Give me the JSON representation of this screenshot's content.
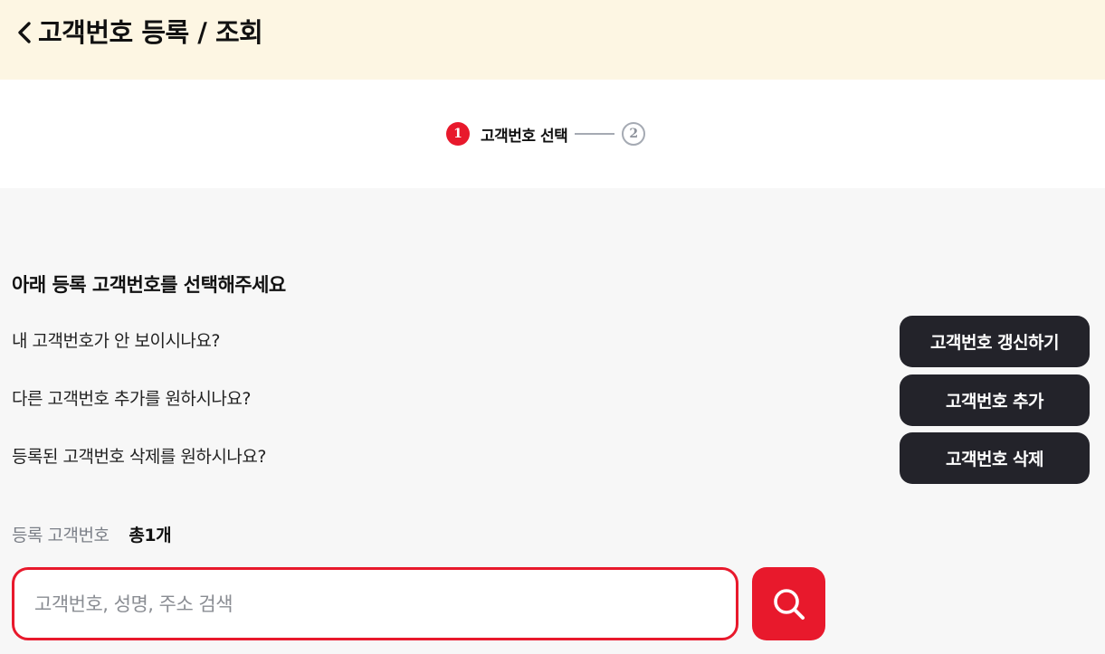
{
  "header": {
    "title": "고객번호 등록 / 조회",
    "back_icon": "chevron-left-icon",
    "background": "#fdf6e3"
  },
  "stepper": {
    "steps": [
      {
        "number": "1",
        "label": "고객번호 선택",
        "active": true
      },
      {
        "number": "2",
        "label": "",
        "active": false
      }
    ],
    "active_color": "#e8192c",
    "inactive_color": "#a5aab3"
  },
  "main": {
    "title": "아래 등록 고객번호를 선택해주세요",
    "questions": [
      {
        "text": "내 고객번호가 안 보이시나요?",
        "button": "고객번호 갱신하기"
      },
      {
        "text": "다른 고객번호 추가를 원하시나요?",
        "button": "고객번호 추가"
      },
      {
        "text": "등록된 고객번호 삭제를 원하시나요?",
        "button": "고객번호 삭제"
      }
    ],
    "button_color": "#23232a"
  },
  "registered": {
    "label": "등록 고객번호",
    "count": "총1개"
  },
  "search": {
    "placeholder": "고객번호, 성명, 주소 검색",
    "value": "",
    "button_icon": "search-icon",
    "accent_color": "#e8192c"
  }
}
